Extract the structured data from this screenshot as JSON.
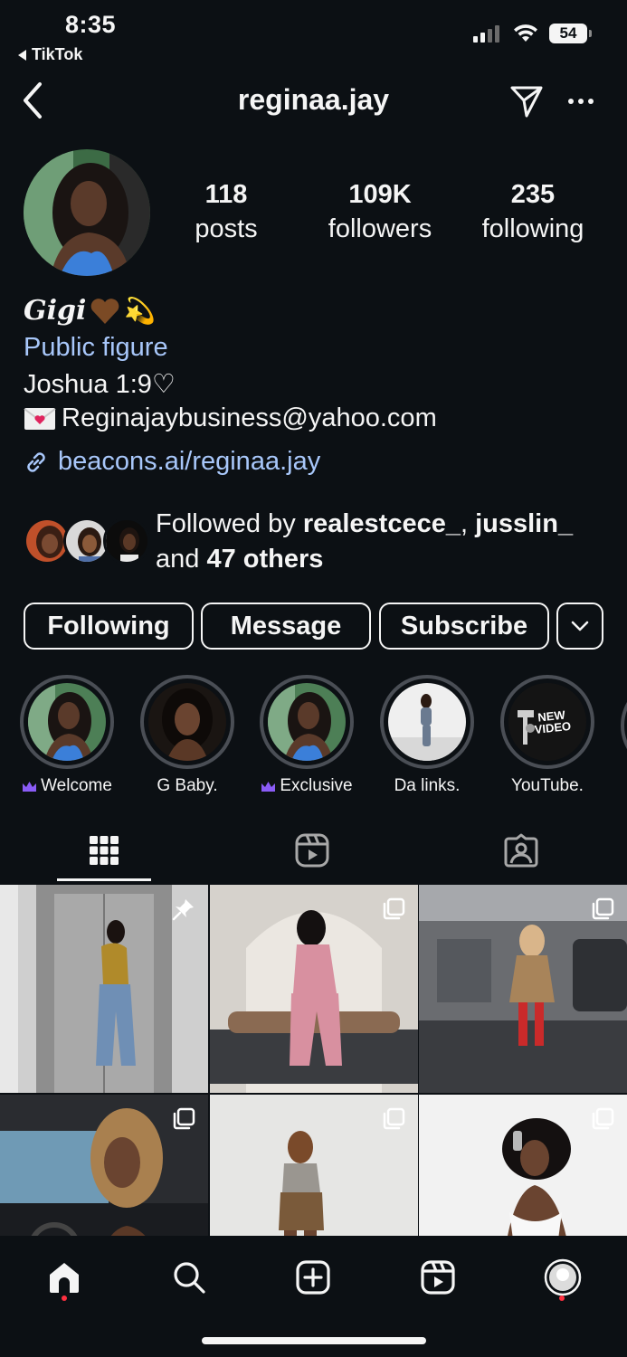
{
  "status_bar": {
    "time": "8:35",
    "back_app": "TikTok",
    "battery": "54"
  },
  "header": {
    "username": "reginaa.jay",
    "icons": [
      "chevron-left-icon",
      "paper-plane-icon",
      "more-horizontal-icon"
    ]
  },
  "profile": {
    "stats": [
      {
        "value": "118",
        "label": "posts"
      },
      {
        "value": "109K",
        "label": "followers"
      },
      {
        "value": "235",
        "label": "following"
      }
    ],
    "name": "Gigi",
    "name_emoji": "💫",
    "category": "Public figure",
    "bio_line1": "Joshua 1:9♡",
    "bio_line2": "Reginajaybusiness@yahoo.com",
    "link": "beacons.ai/reginaa.jay"
  },
  "followed_by": {
    "prefix": "Followed by",
    "user1": "realestcece_",
    "separator": ",",
    "user2": "jusslin_",
    "conjunction": "and",
    "others": "47 others"
  },
  "actions": {
    "following": "Following",
    "message": "Message",
    "subscribe": "Subscribe"
  },
  "highlights": [
    {
      "label": "Welcome",
      "crown": true
    },
    {
      "label": "G Baby.",
      "crown": false
    },
    {
      "label": "Exclusive",
      "crown": true
    },
    {
      "label": "Da links.",
      "crown": false
    },
    {
      "label": "YouTube.",
      "crown": false,
      "overlay_line1": "NEW",
      "overlay_line2": "VIDEO"
    }
  ],
  "tabs": [
    "grid-icon",
    "reels-icon",
    "tagged-icon"
  ],
  "grid_posts": [
    {
      "badge": "pin-icon"
    },
    {
      "badge": "carousel-icon"
    },
    {
      "badge": "carousel-icon"
    },
    {
      "badge": "carousel-icon"
    },
    {
      "badge": "carousel-icon"
    },
    {
      "badge": "carousel-icon"
    }
  ],
  "bottom_nav": [
    "home-icon",
    "search-icon",
    "create-icon",
    "reels-icon",
    "profile-icon"
  ],
  "colors": {
    "background": "#0c1014",
    "text": "#f5f5f5",
    "link": "#a8c7fa",
    "crown": "#8a5cf6",
    "notification_dot": "#ff3040",
    "highlight_ring": "#4a4e55"
  }
}
